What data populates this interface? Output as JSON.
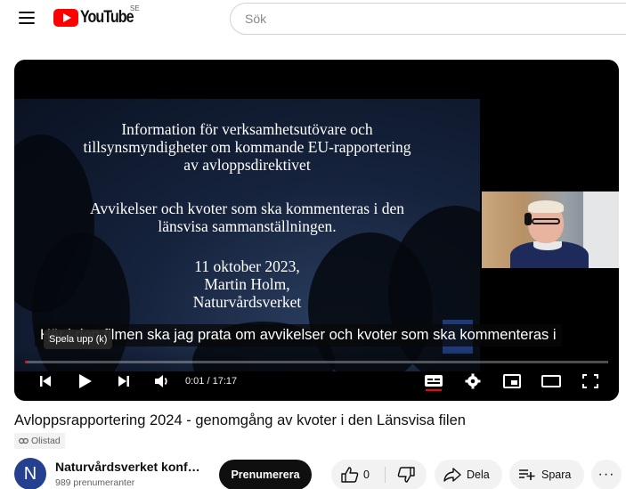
{
  "masthead": {
    "logo_text": "YouTube",
    "country_code": "SE",
    "search_placeholder": "Sök"
  },
  "player": {
    "slide": {
      "line1": "Information för verksamhetsutövare och",
      "line2": "tillsynsmyndigheter om kommande EU-rapportering",
      "line3": "av avloppsdirektivet",
      "line4": "Avvikelser och kvoter som ska kommenteras i den",
      "line5": "länsvisa sammanställningen.",
      "line6": "11 oktober 2023,",
      "line7": "Martin Holm,",
      "line8": "Naturvårdsverket"
    },
    "subtitle": "Här i den filmen ska jag prata om avvikelser och kvoter som ska kommenteras i",
    "tooltip": "Spela upp (k)",
    "time": "0:01 / 17:17",
    "progress_fraction": 0.001,
    "accent_color": "#ff0000",
    "icons": [
      "previous-icon",
      "play-icon",
      "next-icon",
      "volume-icon",
      "subtitles-icon",
      "settings-gear-icon",
      "miniplayer-icon",
      "theater-mode-icon",
      "fullscreen-icon"
    ]
  },
  "video": {
    "title": "Avloppsrapportering 2024 - genomgång av kvoter i den Länsvisa filen",
    "visibility": "Olistad"
  },
  "channel": {
    "avatar_letter": "N",
    "name": "Naturvårdsverket konf…",
    "subscribers": "989 prenumeranter",
    "subscribe_label": "Prenumerera"
  },
  "actions": {
    "like_count": "0",
    "share_label": "Dela",
    "save_label": "Spara",
    "more_label": "···"
  }
}
